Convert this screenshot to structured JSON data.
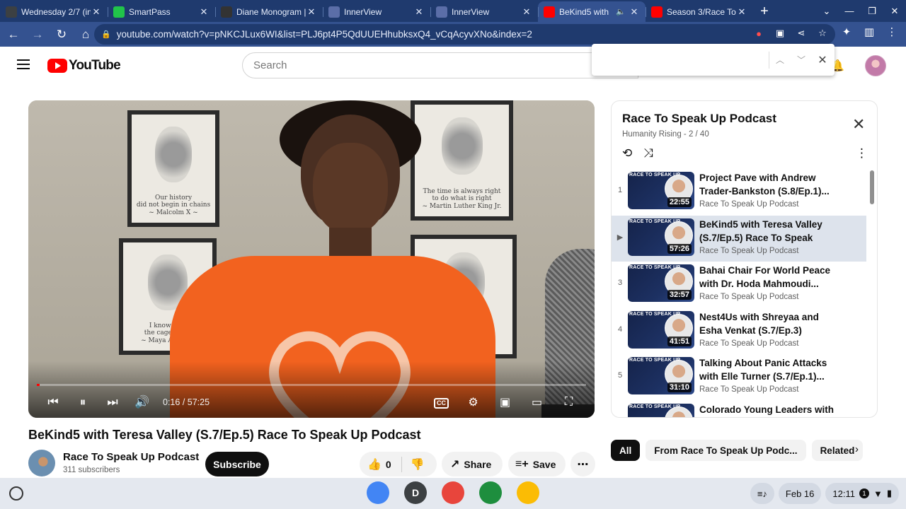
{
  "browser": {
    "tabs": [
      {
        "title": "Wednesday 2/7 (in",
        "favicon_color": "#3c4043",
        "icon": "classroom-icon",
        "active": false
      },
      {
        "title": "SmartPass",
        "favicon_color": "#21c44a",
        "icon": "smartpass-icon",
        "active": false
      },
      {
        "title": "Diane Monogram |",
        "favicon_color": "#333333",
        "icon": "lv-icon",
        "active": false
      },
      {
        "title": "InnerView",
        "favicon_color": "#5b6ea8",
        "icon": "innerview-icon",
        "active": false
      },
      {
        "title": "InnerView",
        "favicon_color": "#5b6ea8",
        "icon": "innerview-icon",
        "active": false
      },
      {
        "title": "BeKind5 with",
        "favicon_color": "#ff0000",
        "icon": "youtube-icon",
        "active": true
      },
      {
        "title": "Season 3/Race To",
        "favicon_color": "#ff0000",
        "icon": "youtube-icon",
        "active": false
      }
    ],
    "url": "youtube.com/watch?v=pNKCJLux6WI&list=PLJ6pt4P5QdUUEHhubksxQ4_vCqAcyvXNo&index=2"
  },
  "youtube": {
    "logo_text": "YouTube",
    "search_placeholder": "Search",
    "find_value": ""
  },
  "player": {
    "time_current": "0:16",
    "time_total": "57:25",
    "progress_fraction": 0.005,
    "cc_label": "CC"
  },
  "video": {
    "title": "BeKind5 with Teresa Valley (S.7/Ep.5) Race To Speak Up Podcast",
    "channel": "Race To Speak Up Podcast",
    "subscribers": "311 subscribers",
    "subscribe_label": "Subscribe",
    "likes": "0",
    "share_label": "Share",
    "save_label": "Save"
  },
  "playlist": {
    "title": "Race To Speak Up Podcast",
    "subtitle": "Humanity Rising - 2 / 40",
    "thumb_brand": "RACE TO SPEAK UP",
    "items": [
      {
        "index": "1",
        "title": "Project Pave with Andrew Trader-Bankston (S.8/Ep.1)...",
        "channel": "Race To Speak Up Podcast",
        "duration": "22:55",
        "active": false
      },
      {
        "index": "▶",
        "title": "BeKind5 with Teresa Valley (S.7/Ep.5) Race To Speak Up...",
        "channel": "Race To Speak Up Podcast",
        "duration": "57:26",
        "active": true
      },
      {
        "index": "3",
        "title": "Bahai Chair For World Peace with Dr. Hoda Mahmoudi...",
        "channel": "Race To Speak Up Podcast",
        "duration": "32:57",
        "active": false
      },
      {
        "index": "4",
        "title": "Nest4Us with Shreyaa and Esha Venkat (S.7/Ep.3) Race...",
        "channel": "Race To Speak Up Podcast",
        "duration": "41:51",
        "active": false
      },
      {
        "index": "5",
        "title": "Talking About Panic Attacks with Elle Turner (S.7/Ep.1)...",
        "channel": "Race To Speak Up Podcast",
        "duration": "31:10",
        "active": false
      },
      {
        "index": "",
        "title": "Colorado Young Leaders with",
        "channel": "",
        "duration": "",
        "active": false
      }
    ]
  },
  "chips": [
    "All",
    "From Race To Speak Up Podc...",
    "Related"
  ],
  "shelf": {
    "date": "Feb 16",
    "time": "12:11",
    "notif_count": "1",
    "apps": [
      {
        "name": "chrome-app",
        "color": "#4285f4",
        "label": ""
      },
      {
        "name": "account-app",
        "color": "#3c4043",
        "label": "D"
      },
      {
        "name": "paint-app",
        "color": "#e8453c",
        "label": ""
      },
      {
        "name": "classroom-app",
        "color": "#1e8e3e",
        "label": ""
      },
      {
        "name": "drive-app",
        "color": "#fbbc04",
        "label": ""
      }
    ]
  }
}
